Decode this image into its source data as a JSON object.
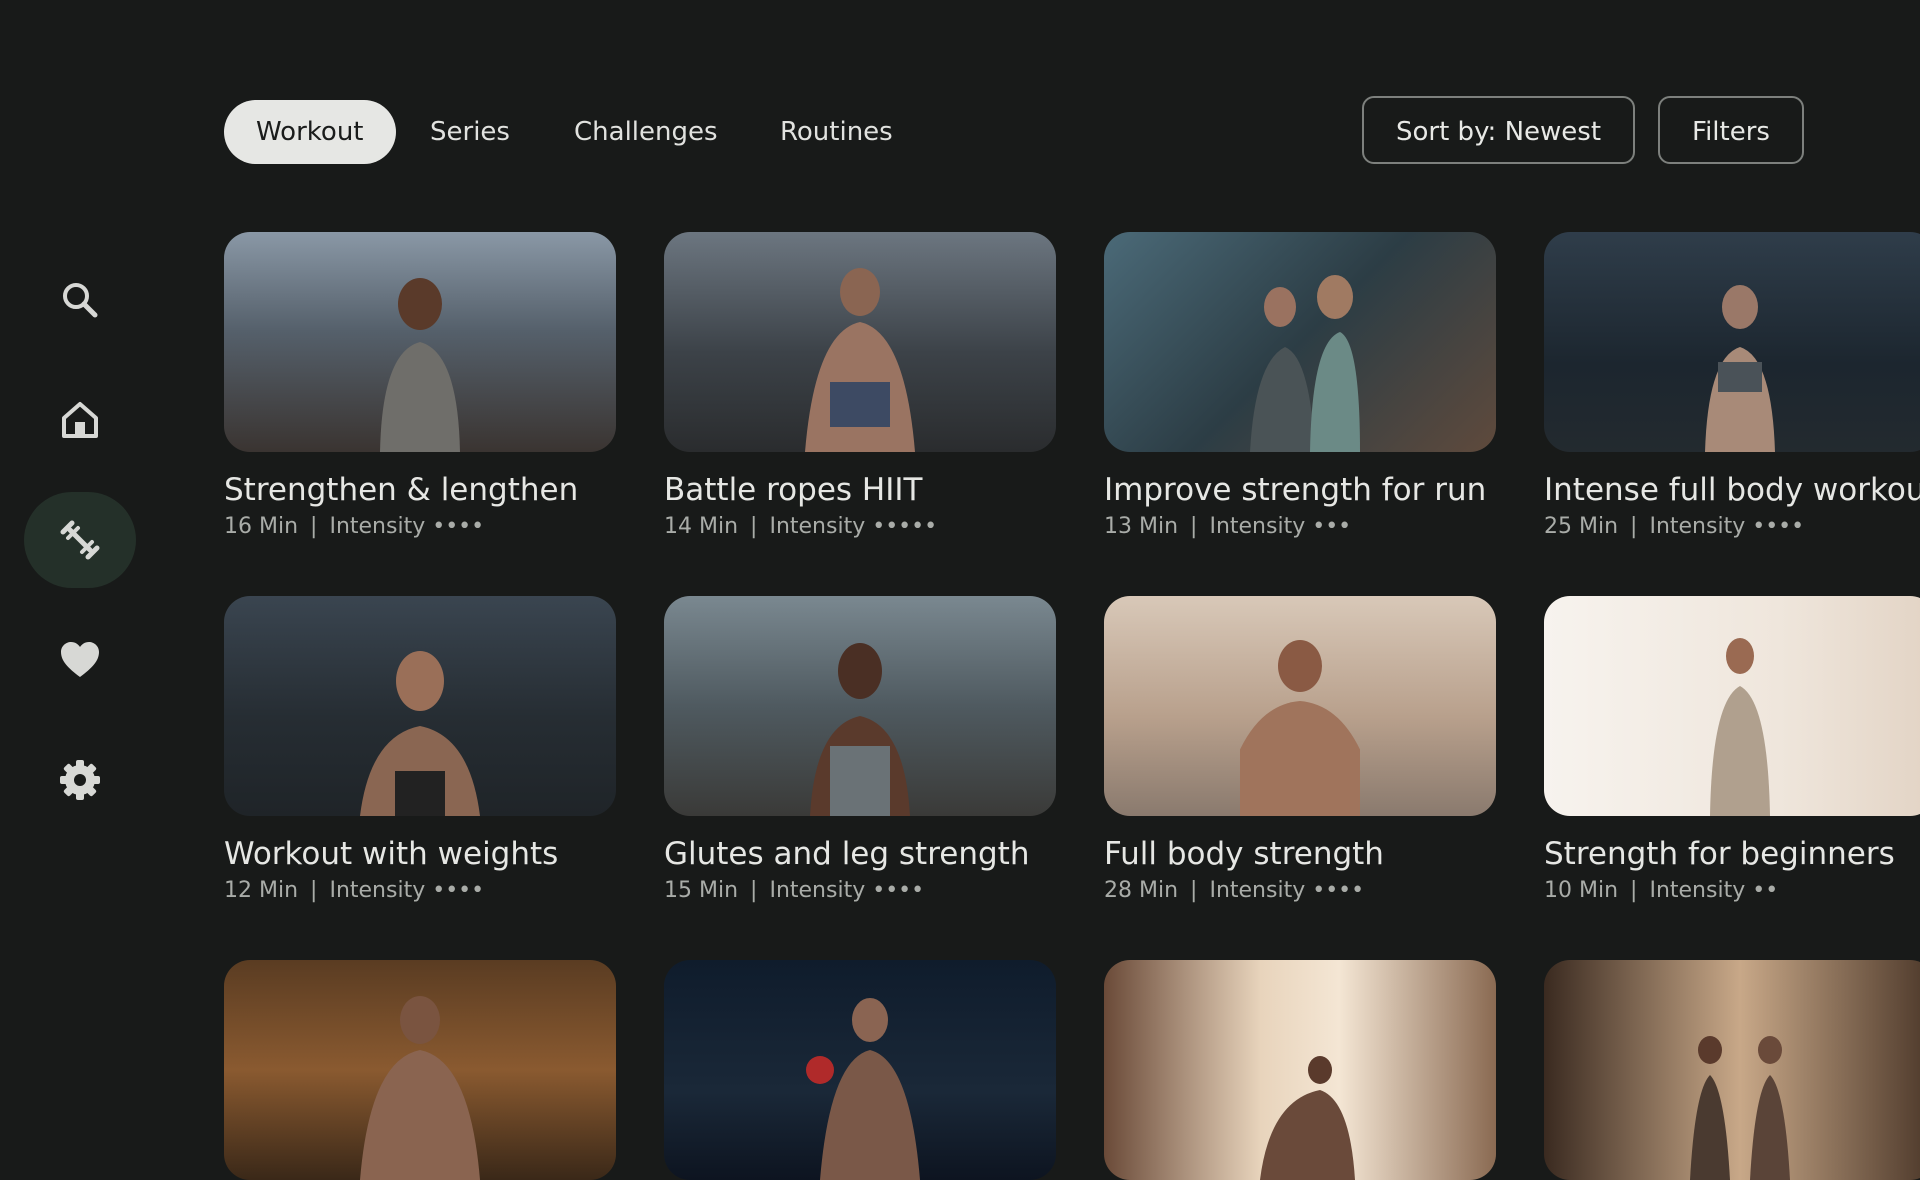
{
  "nav": {
    "items": [
      {
        "name": "search",
        "active": false
      },
      {
        "name": "home",
        "active": false
      },
      {
        "name": "workouts",
        "active": true
      },
      {
        "name": "favorites",
        "active": false
      },
      {
        "name": "settings",
        "active": false
      }
    ]
  },
  "tabs": [
    "Workout",
    "Series",
    "Challenges",
    "Routines"
  ],
  "active_tab": "Workout",
  "sort_label": "Sort by: Newest",
  "filters_label": "Filters",
  "cards": [
    {
      "title": "Strengthen & lengthen",
      "duration": "16 Min",
      "intensity_label": "Intensity",
      "intensity_dots": "••••"
    },
    {
      "title": "Battle ropes HIIT",
      "duration": "14 Min",
      "intensity_label": "Intensity",
      "intensity_dots": "•••••"
    },
    {
      "title": "Improve strength for run",
      "duration": "13 Min",
      "intensity_label": "Intensity",
      "intensity_dots": "•••"
    },
    {
      "title": "Intense full body workout",
      "duration": "25 Min",
      "intensity_label": "Intensity",
      "intensity_dots": "••••"
    },
    {
      "title": "Workout with weights",
      "duration": "12 Min",
      "intensity_label": "Intensity",
      "intensity_dots": "••••"
    },
    {
      "title": "Glutes and leg strength",
      "duration": "15 Min",
      "intensity_label": "Intensity",
      "intensity_dots": "••••"
    },
    {
      "title": "Full body strength",
      "duration": "28 Min",
      "intensity_label": "Intensity",
      "intensity_dots": "••••"
    },
    {
      "title": "Strength for beginners",
      "duration": "10 Min",
      "intensity_label": "Intensity",
      "intensity_dots": "••"
    },
    {
      "title": "",
      "duration": "",
      "intensity_label": "",
      "intensity_dots": ""
    },
    {
      "title": "",
      "duration": "",
      "intensity_label": "",
      "intensity_dots": ""
    },
    {
      "title": "",
      "duration": "",
      "intensity_label": "",
      "intensity_dots": ""
    },
    {
      "title": "",
      "duration": "",
      "intensity_label": "",
      "intensity_dots": ""
    }
  ],
  "colors": {
    "background": "#181a19",
    "nav_active": "#243029",
    "tab_active": "#e6e7e4"
  }
}
